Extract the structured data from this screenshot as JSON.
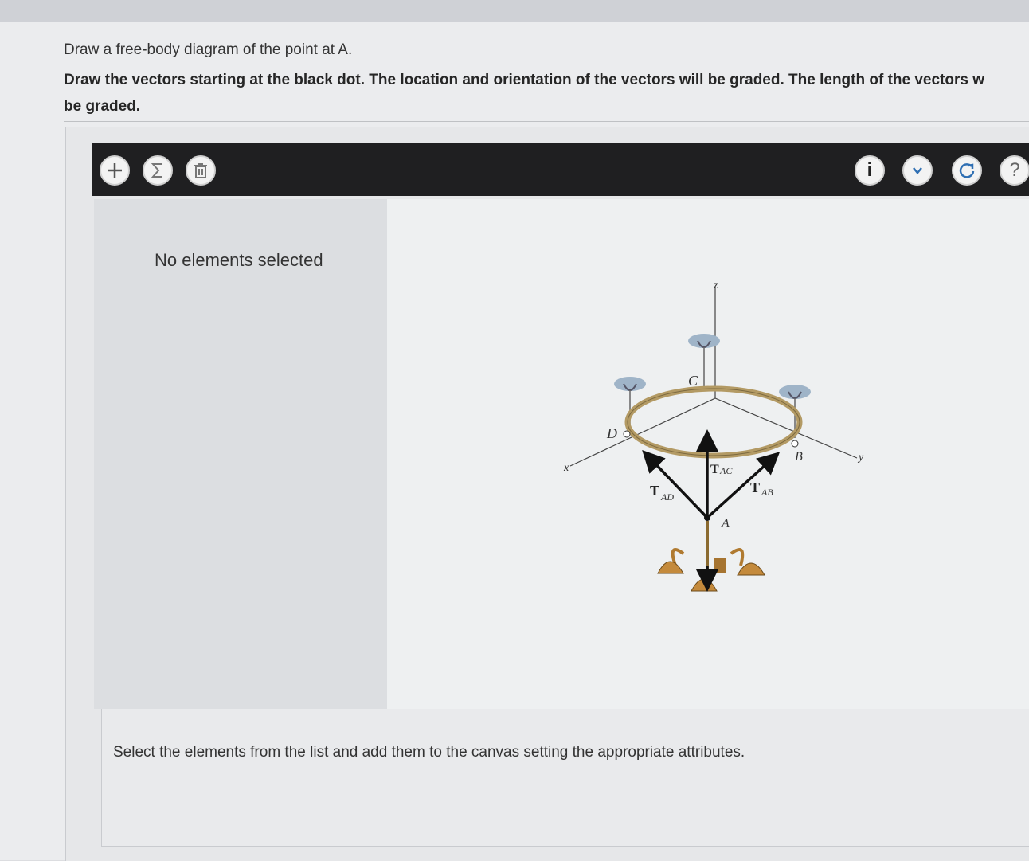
{
  "question": {
    "line1": "Draw a free-body diagram of the point at A.",
    "line2a": "Draw the vectors starting at the black dot. The location and orientation of the vectors will be graded. The length of the vectors w",
    "line2b": "be graded."
  },
  "toolbar": {
    "add_icon": "plus-icon",
    "sum_icon": "sigma-icon",
    "trash_icon": "trash-icon",
    "info_icon": "info-icon",
    "menu_icon": "chevron-down-icon",
    "reset_icon": "reset-icon",
    "help_icon": "help-icon",
    "info_label": "i",
    "help_label": "?"
  },
  "side_panel": {
    "status": "No elements selected"
  },
  "figure": {
    "labels": {
      "z": "z",
      "x": "x",
      "y": "y",
      "C": "C",
      "D": "D",
      "B": "B",
      "A": "A",
      "T": "T",
      "AC": "AC",
      "AD": "AD",
      "AB": "AB"
    }
  },
  "footer": {
    "hint": "Select the elements from the list and add them to the canvas setting the appropriate attributes."
  },
  "colors": {
    "toolbar": "#1f1f21",
    "ring": "#b39a64",
    "lamp": "#c48a3c"
  }
}
